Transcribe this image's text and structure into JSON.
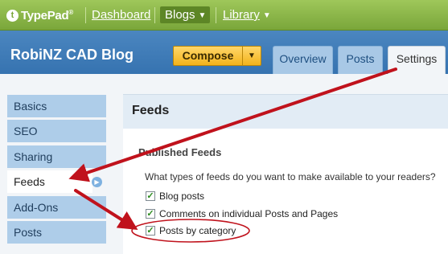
{
  "nav": {
    "logo_mark": "t",
    "logo_text": "TypePad",
    "logo_reg": "®",
    "dashboard": "Dashboard",
    "blogs": "Blogs",
    "library": "Library",
    "dropdown_glyph": "▼"
  },
  "blog": {
    "title": "RobiNZ CAD Blog",
    "compose": "Compose",
    "compose_arrow": "▼",
    "tabs": [
      {
        "label": "Overview",
        "active": false
      },
      {
        "label": "Posts",
        "active": false
      },
      {
        "label": "Settings",
        "active": true
      }
    ]
  },
  "sidebar": {
    "items": [
      {
        "label": "Basics"
      },
      {
        "label": "SEO"
      },
      {
        "label": "Sharing"
      },
      {
        "label": "Feeds",
        "active": true
      },
      {
        "label": "Add-Ons"
      },
      {
        "label": "Posts"
      }
    ],
    "active_indicator": "▶"
  },
  "main": {
    "section_title": "Feeds",
    "group_title": "Published Feeds",
    "question": "What types of feeds do you want to make available to your readers?",
    "options": [
      {
        "label": "Blog posts",
        "checked": true
      },
      {
        "label": "Comments on individual Posts and Pages",
        "checked": true
      },
      {
        "label": "Posts by category",
        "checked": true
      }
    ],
    "check_glyph": "✓"
  },
  "colors": {
    "nav_green": "#7aa63a",
    "blog_blue": "#3673b0",
    "compose_yellow": "#f3b31b",
    "sidebar_blue": "#aecde9",
    "annotation_red": "#c0121c"
  }
}
